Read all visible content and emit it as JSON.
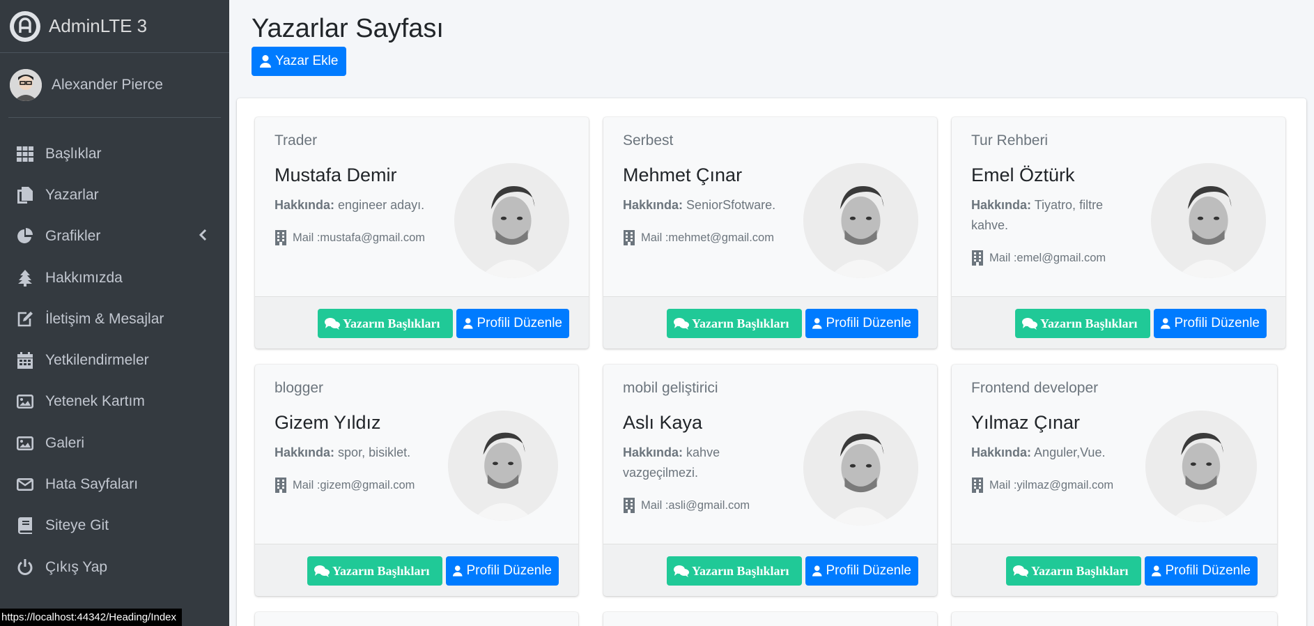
{
  "brand": {
    "title": "AdminLTE 3"
  },
  "user": {
    "name": "Alexander Pierce"
  },
  "sidebar": {
    "items": [
      {
        "label": "Başlıklar",
        "icon": "grid-icon"
      },
      {
        "label": "Yazarlar",
        "icon": "copy-icon"
      },
      {
        "label": "Grafikler",
        "icon": "pie-chart-icon"
      },
      {
        "label": "Hakkımızda",
        "icon": "tree-icon"
      },
      {
        "label": "İletişim & Mesajlar",
        "icon": "edit-icon"
      },
      {
        "label": "Yetkilendirmeler",
        "icon": "calendar-icon"
      },
      {
        "label": "Yetenek Kartım",
        "icon": "image-icon"
      },
      {
        "label": "Galeri",
        "icon": "image-icon"
      },
      {
        "label": "Hata Sayfaları",
        "icon": "envelope-icon"
      },
      {
        "label": "Siteye Git",
        "icon": "book-icon"
      },
      {
        "label": "Çıkış Yap",
        "icon": "power-icon"
      }
    ]
  },
  "page": {
    "title": "Yazarlar Sayfası",
    "add_button": "Yazar Ekle"
  },
  "labels": {
    "about": "Hakkında:",
    "mail_prefix": "Mail : ",
    "headings_button": "Yazarın Başlıkları",
    "edit_button": "Profili Düzenle"
  },
  "authors": [
    {
      "role": "Trader",
      "name": "Mustafa Demir",
      "about": "engineer adayı.",
      "mail": "mustafa@gmail.com"
    },
    {
      "role": "Serbest",
      "name": "Mehmet Çınar",
      "about": "SeniorSfotware.",
      "mail": "mehmet@gmail.com"
    },
    {
      "role": "Tur Rehberi",
      "name": "Emel Öztürk",
      "about": "Tiyatro, filtre kahve.",
      "mail": "emel@gmail.com"
    },
    {
      "role": "blogger",
      "name": "Gizem Yıldız",
      "about": "spor, bisiklet.",
      "mail": "gizem@gmail.com"
    },
    {
      "role": "mobil geliştirici",
      "name": "Aslı Kaya",
      "about": "kahve vazgeçilmezi.",
      "mail": "asli@gmail.com"
    },
    {
      "role": "Frontend developer",
      "name": "Yılmaz Çınar",
      "about": "Anguler,Vue.",
      "mail": "yilmaz@gmail.com"
    }
  ],
  "status_bar": {
    "url": "https://localhost:44342/Heading/Index"
  },
  "colors": {
    "sidebar": "#343a40",
    "primary": "#007bff",
    "teal": "#20c997",
    "background": "#f4f6f9"
  }
}
